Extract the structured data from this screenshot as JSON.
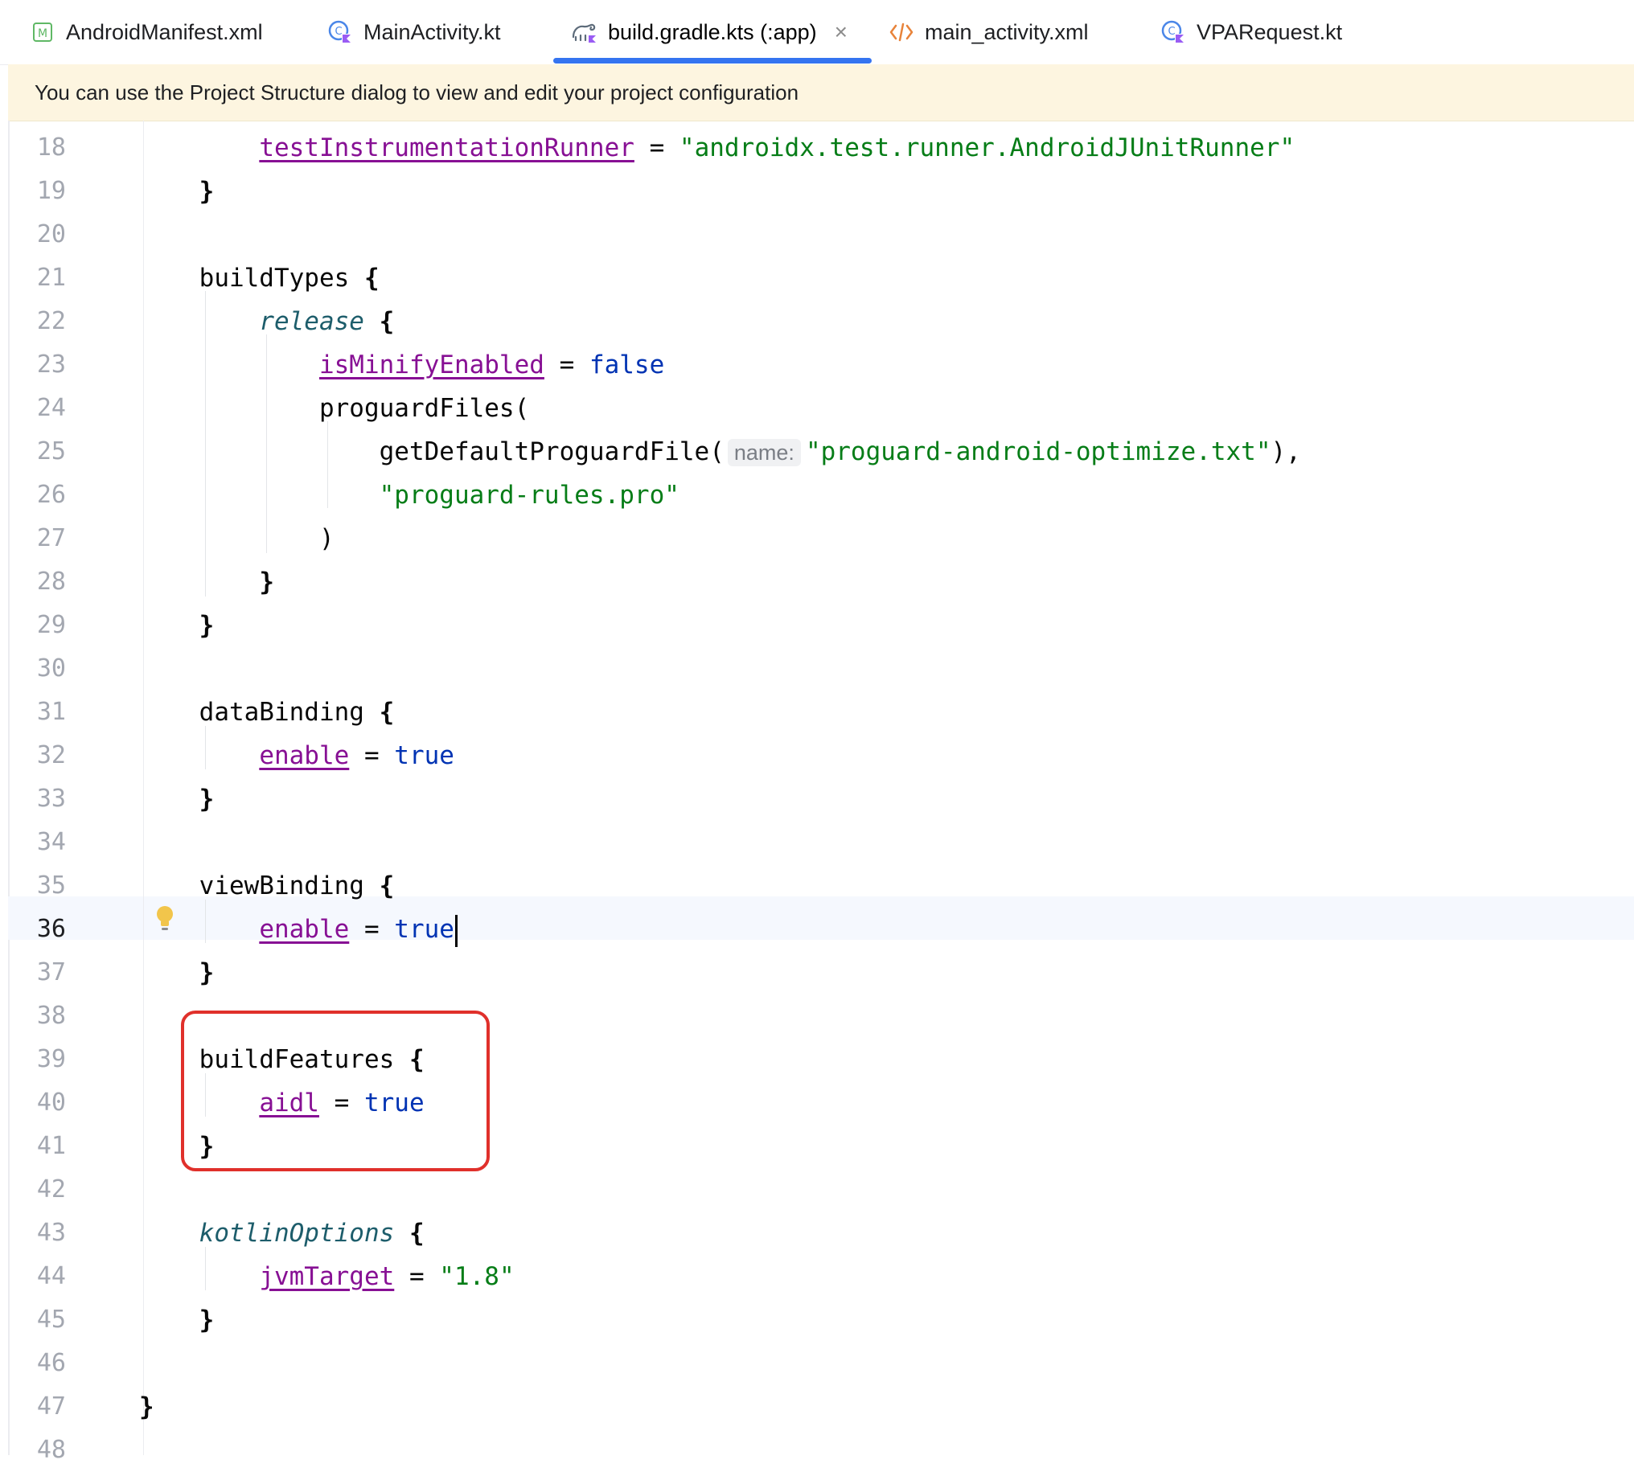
{
  "tabs": [
    {
      "label": "AndroidManifest.xml",
      "icon": "manifest-icon",
      "active": false
    },
    {
      "label": "MainActivity.kt",
      "icon": "kotlin-class-icon",
      "active": false
    },
    {
      "label": "build.gradle.kts (:app)",
      "icon": "gradle-icon",
      "active": true,
      "close": "×"
    },
    {
      "label": "main_activity.xml",
      "icon": "xml-icon",
      "active": false
    },
    {
      "label": "VPARequest.kt",
      "icon": "kotlin-class-icon",
      "active": false
    }
  ],
  "banner": {
    "text": "You can use the Project Structure dialog to view and edit your project configuration"
  },
  "editor": {
    "current_line": 36,
    "lines": [
      {
        "n": "18",
        "indent": "        ",
        "parts": [
          {
            "t": "testInstrumentationRunner",
            "c": "prop"
          },
          {
            "t": " = "
          },
          {
            "t": "\"androidx.test.runner.AndroidJUnitRunner\"",
            "c": "str"
          }
        ]
      },
      {
        "n": "19",
        "indent": "    ",
        "parts": [
          {
            "t": "}",
            "c": "brace"
          }
        ]
      },
      {
        "n": "20",
        "indent": "",
        "parts": []
      },
      {
        "n": "21",
        "indent": "    ",
        "parts": [
          {
            "t": "buildTypes "
          },
          {
            "t": "{",
            "c": "brace"
          }
        ]
      },
      {
        "n": "22",
        "indent": "        ",
        "parts": [
          {
            "t": "release",
            "c": "ital"
          },
          {
            "t": " "
          },
          {
            "t": "{",
            "c": "brace"
          }
        ]
      },
      {
        "n": "23",
        "indent": "            ",
        "parts": [
          {
            "t": "isMinifyEnabled",
            "c": "prop"
          },
          {
            "t": " = "
          },
          {
            "t": "false",
            "c": "kw"
          }
        ]
      },
      {
        "n": "24",
        "indent": "            ",
        "parts": [
          {
            "t": "proguardFiles("
          }
        ]
      },
      {
        "n": "25",
        "indent": "                ",
        "parts": [
          {
            "t": "getDefaultProguardFile("
          },
          {
            "t": "name:",
            "c": "hint"
          },
          {
            "t": "\"proguard-android-optimize.txt\"",
            "c": "str"
          },
          {
            "t": "),"
          }
        ]
      },
      {
        "n": "26",
        "indent": "                ",
        "parts": [
          {
            "t": "\"proguard-rules.pro\"",
            "c": "str"
          }
        ]
      },
      {
        "n": "27",
        "indent": "            ",
        "parts": [
          {
            "t": ")"
          }
        ]
      },
      {
        "n": "28",
        "indent": "        ",
        "parts": [
          {
            "t": "}",
            "c": "brace"
          }
        ]
      },
      {
        "n": "29",
        "indent": "    ",
        "parts": [
          {
            "t": "}",
            "c": "brace"
          }
        ]
      },
      {
        "n": "30",
        "indent": "",
        "parts": []
      },
      {
        "n": "31",
        "indent": "    ",
        "parts": [
          {
            "t": "dataBinding "
          },
          {
            "t": "{",
            "c": "brace"
          }
        ]
      },
      {
        "n": "32",
        "indent": "        ",
        "parts": [
          {
            "t": "enable",
            "c": "prop"
          },
          {
            "t": " = "
          },
          {
            "t": "true",
            "c": "kw"
          }
        ]
      },
      {
        "n": "33",
        "indent": "    ",
        "parts": [
          {
            "t": "}",
            "c": "brace"
          }
        ]
      },
      {
        "n": "34",
        "indent": "",
        "parts": []
      },
      {
        "n": "35",
        "indent": "    ",
        "parts": [
          {
            "t": "viewBinding "
          },
          {
            "t": "{",
            "c": "brace"
          }
        ]
      },
      {
        "n": "36",
        "indent": "        ",
        "parts": [
          {
            "t": "enable",
            "c": "prop"
          },
          {
            "t": " = "
          },
          {
            "t": "true",
            "c": "kw"
          },
          {
            "t": "",
            "c": "caret"
          }
        ]
      },
      {
        "n": "37",
        "indent": "    ",
        "parts": [
          {
            "t": "}",
            "c": "brace"
          }
        ]
      },
      {
        "n": "38",
        "indent": "",
        "parts": []
      },
      {
        "n": "39",
        "indent": "    ",
        "parts": [
          {
            "t": "buildFeatures "
          },
          {
            "t": "{",
            "c": "brace"
          }
        ]
      },
      {
        "n": "40",
        "indent": "        ",
        "parts": [
          {
            "t": "aidl",
            "c": "prop"
          },
          {
            "t": " = "
          },
          {
            "t": "true",
            "c": "kw"
          }
        ]
      },
      {
        "n": "41",
        "indent": "    ",
        "parts": [
          {
            "t": "}",
            "c": "brace"
          }
        ]
      },
      {
        "n": "42",
        "indent": "",
        "parts": []
      },
      {
        "n": "43",
        "indent": "    ",
        "parts": [
          {
            "t": "kotlinOptions",
            "c": "ital"
          },
          {
            "t": " "
          },
          {
            "t": "{",
            "c": "brace"
          }
        ]
      },
      {
        "n": "44",
        "indent": "        ",
        "parts": [
          {
            "t": "jvmTarget",
            "c": "prop"
          },
          {
            "t": " = "
          },
          {
            "t": "\"1.8\"",
            "c": "str"
          }
        ]
      },
      {
        "n": "45",
        "indent": "    ",
        "parts": [
          {
            "t": "}",
            "c": "brace"
          }
        ]
      },
      {
        "n": "46",
        "indent": "",
        "parts": []
      },
      {
        "n": "47",
        "indent": "",
        "parts": [
          {
            "t": "}",
            "c": "brace"
          }
        ]
      },
      {
        "n": "48",
        "indent": "",
        "parts": []
      }
    ]
  },
  "colors": {
    "accent": "#3574f0",
    "highlight_box": "#e0302b",
    "banner_bg": "#fdf5e0"
  }
}
